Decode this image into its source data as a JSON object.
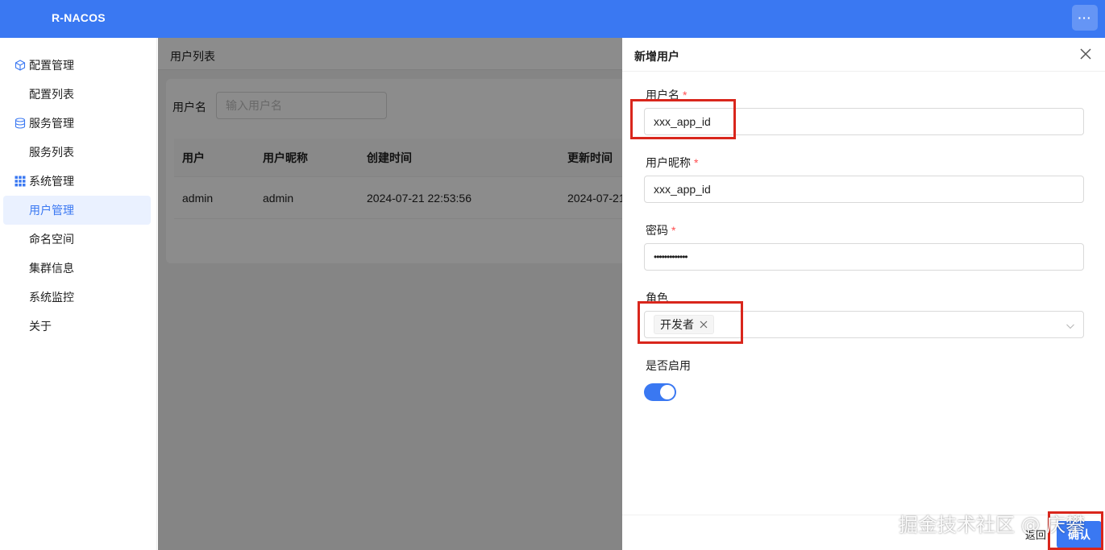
{
  "header": {
    "brand": "R-NACOS",
    "more_label": "···"
  },
  "sidebar": {
    "items": [
      {
        "label": "配置管理",
        "type": "group",
        "icon": "cube-icon"
      },
      {
        "label": "配置列表",
        "type": "child"
      },
      {
        "label": "服务管理",
        "type": "group",
        "icon": "database-icon"
      },
      {
        "label": "服务列表",
        "type": "child"
      },
      {
        "label": "系统管理",
        "type": "group",
        "icon": "grid-icon"
      },
      {
        "label": "用户管理",
        "type": "child",
        "active": true
      },
      {
        "label": "命名空间",
        "type": "child"
      },
      {
        "label": "集群信息",
        "type": "child"
      },
      {
        "label": "系统监控",
        "type": "child"
      },
      {
        "label": "关于",
        "type": "child"
      }
    ]
  },
  "main": {
    "breadcrumb": "用户列表",
    "search": {
      "label": "用户名",
      "placeholder": "输入用户名",
      "value": ""
    },
    "table": {
      "columns": [
        "用户",
        "用户昵称",
        "创建时间",
        "更新时间"
      ],
      "rows": [
        [
          "admin",
          "admin",
          "2024-07-21 22:53:56",
          "2024-07-21"
        ]
      ]
    }
  },
  "drawer": {
    "title": "新增用户",
    "fields": {
      "username": {
        "label": "用户名",
        "value": "xxx_app_id",
        "required": "*"
      },
      "nickname": {
        "label": "用户昵称",
        "value": "xxx_app_id",
        "required": "*"
      },
      "password": {
        "label": "密码",
        "value": "•••••••••••••",
        "required": "*"
      },
      "roles": {
        "label": "角色",
        "selected": [
          "开发者"
        ]
      },
      "enabled": {
        "label": "是否启用",
        "value": true
      }
    },
    "footer": {
      "back_label": "返回",
      "confirm_label": "确认"
    }
  },
  "watermark": "掘金技术社区 @ 庆攀",
  "colors": {
    "primary": "#3a78f2",
    "highlight": "#d9261c",
    "required": "#ff4d4f"
  }
}
